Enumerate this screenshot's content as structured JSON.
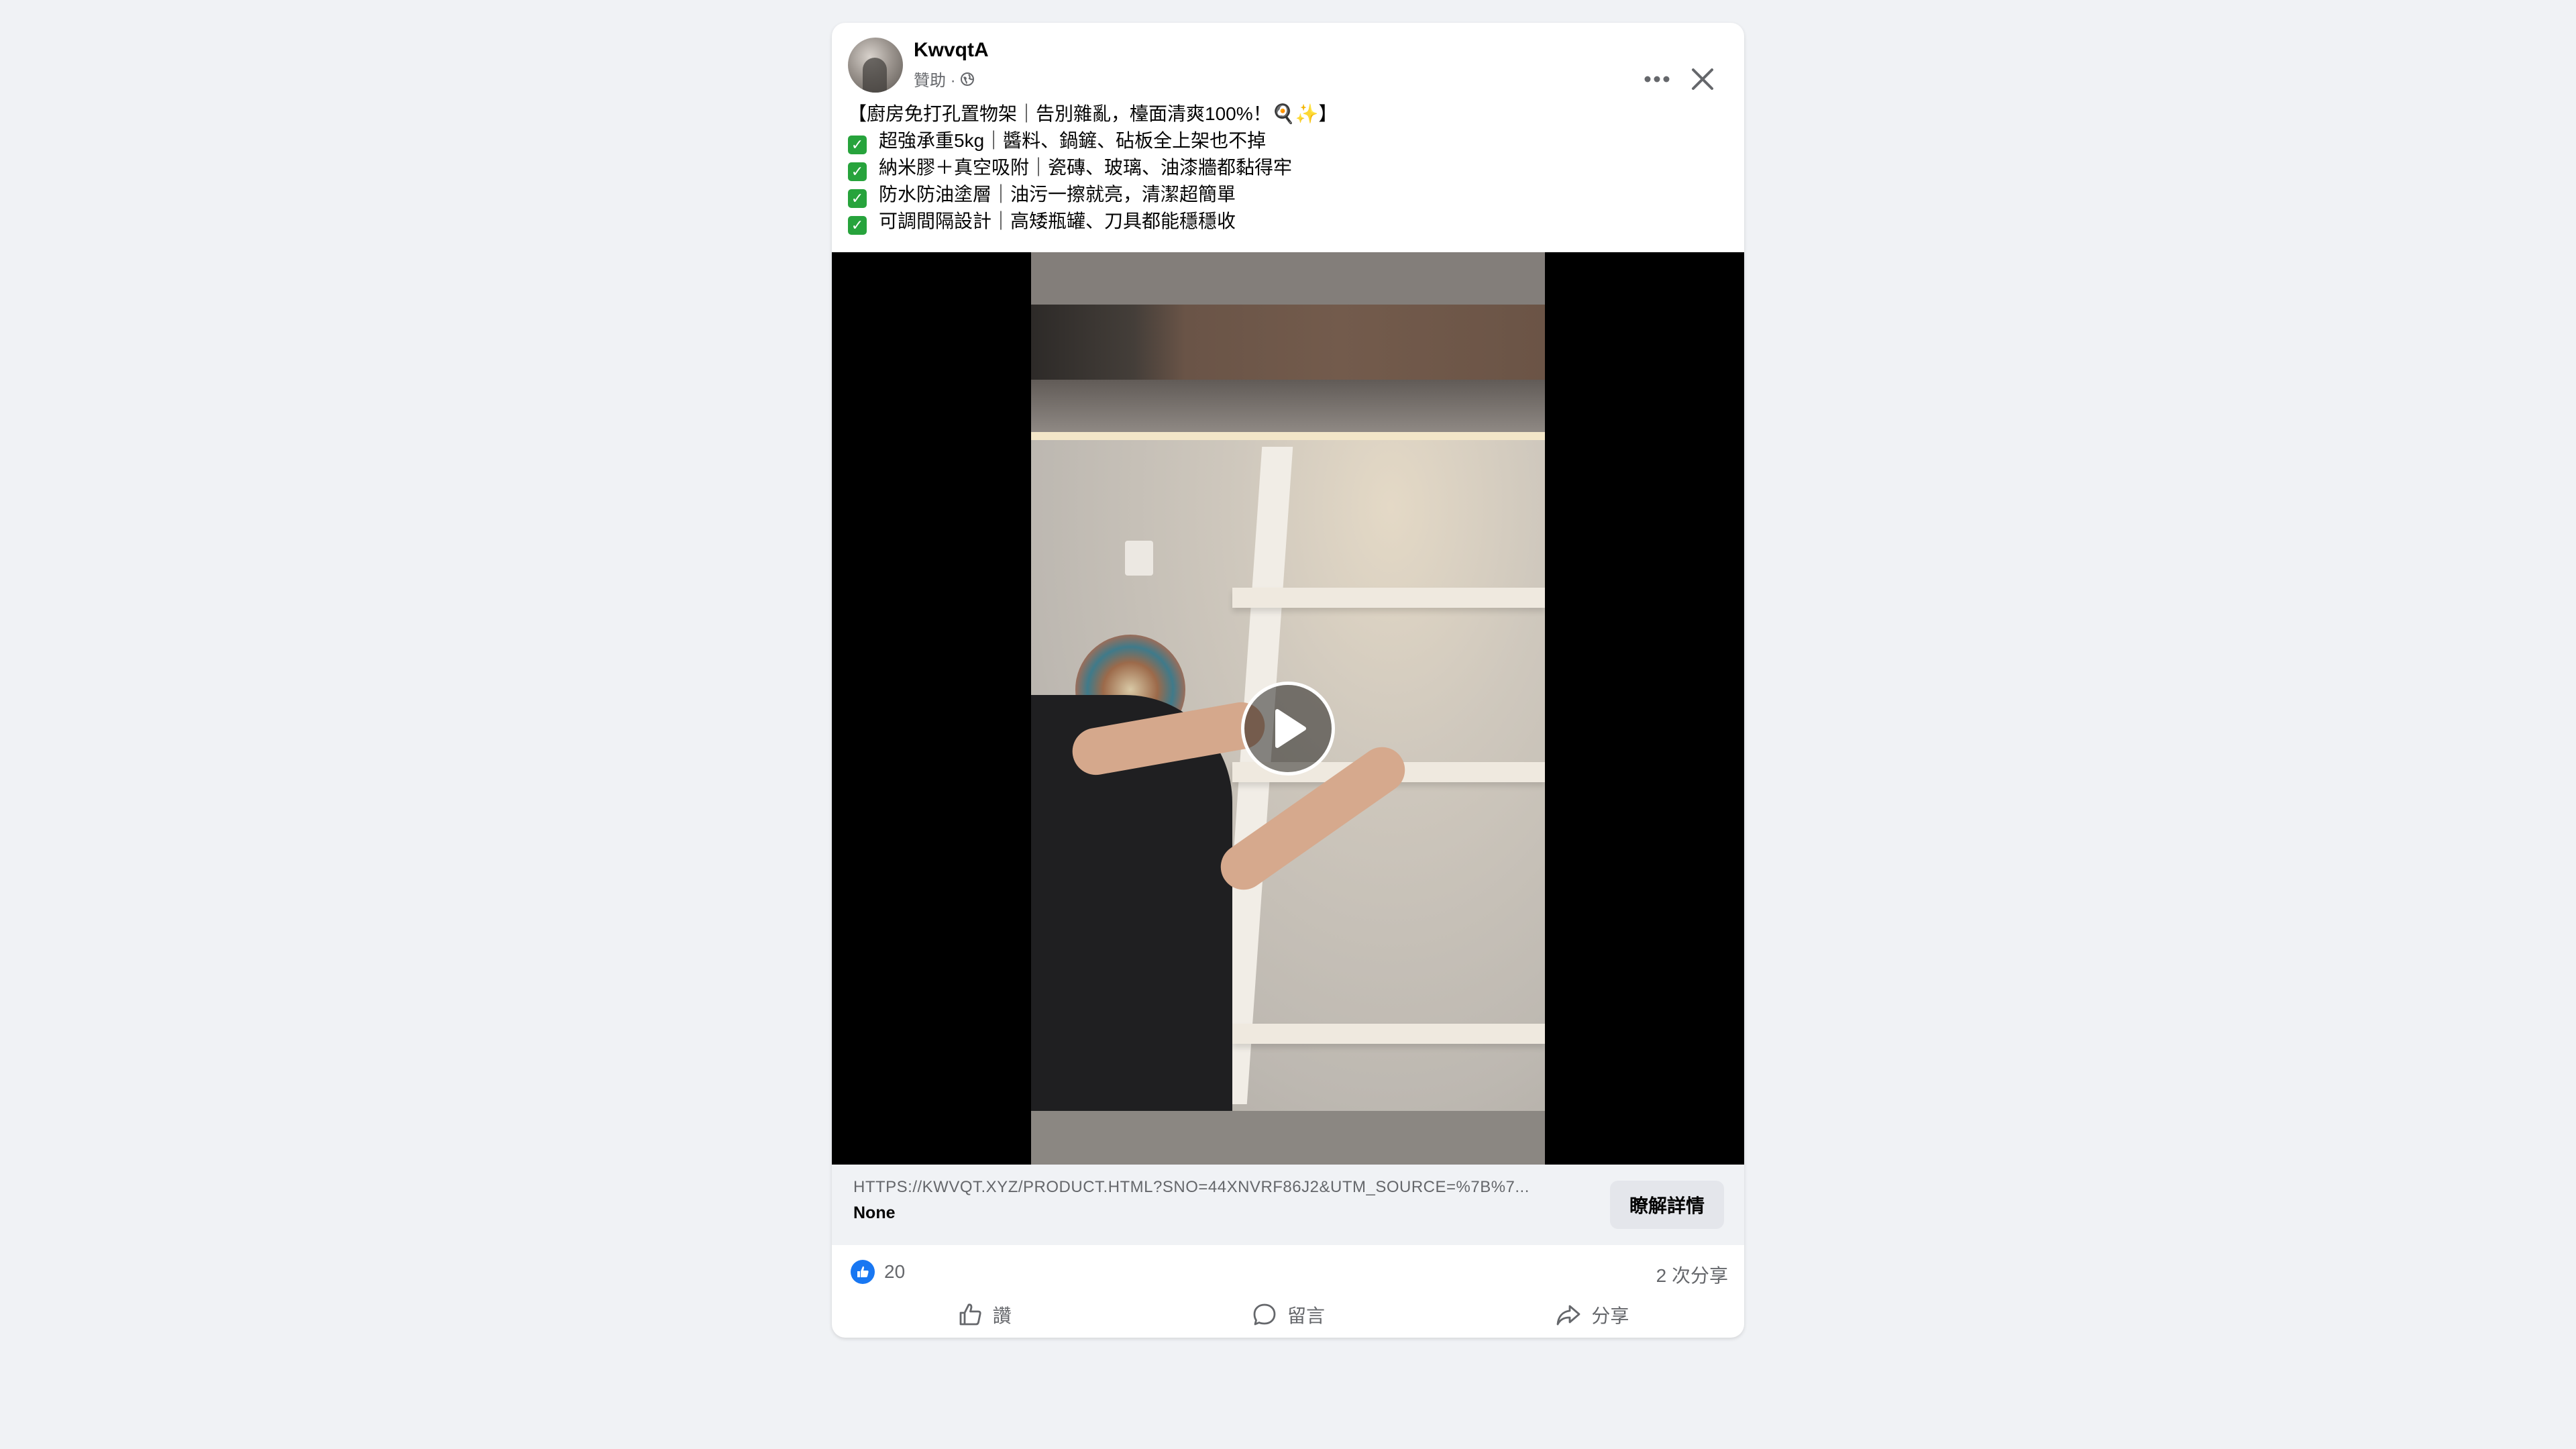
{
  "post": {
    "page_name": "KwvqtA",
    "sponsored_label": "贊助 ·",
    "privacy_icon": "globe-icon",
    "text_lines": [
      "【廚房免打孔置物架｜告別雜亂，檯面清爽100%！🍳✨】",
      "超強承重5kg｜醬料、鍋鏟、砧板全上架也不掉",
      "納米膠＋真空吸附｜瓷磚、玻璃、油漆牆都黏得牢",
      "防水防油塗層｜油污一擦就亮，清潔超簡單",
      "可調間隔設計｜高矮瓶罐、刀具都能穩穩收"
    ],
    "check_icon": "check-mark-button-icon"
  },
  "header_actions": {
    "more_icon": "more-options-icon",
    "close_icon": "close-icon"
  },
  "video": {
    "play_icon": "play-icon"
  },
  "link": {
    "url": "HTTPS://KWVQT.XYZ/PRODUCT.HTML?SNO=44XNVRF86J2&UTM_SOURCE=%7B%7...",
    "title": "None",
    "cta_label": "瞭解詳情"
  },
  "stats": {
    "like_count": "20",
    "share_count": "2 次分享"
  },
  "actions": {
    "like_label": "讚",
    "comment_label": "留言",
    "share_label": "分享"
  },
  "colors": {
    "background": "#f0f2f5",
    "card": "#ffffff",
    "facebook_blue": "#1877f2",
    "secondary_text": "#65676b",
    "check_green": "#27a33c"
  }
}
